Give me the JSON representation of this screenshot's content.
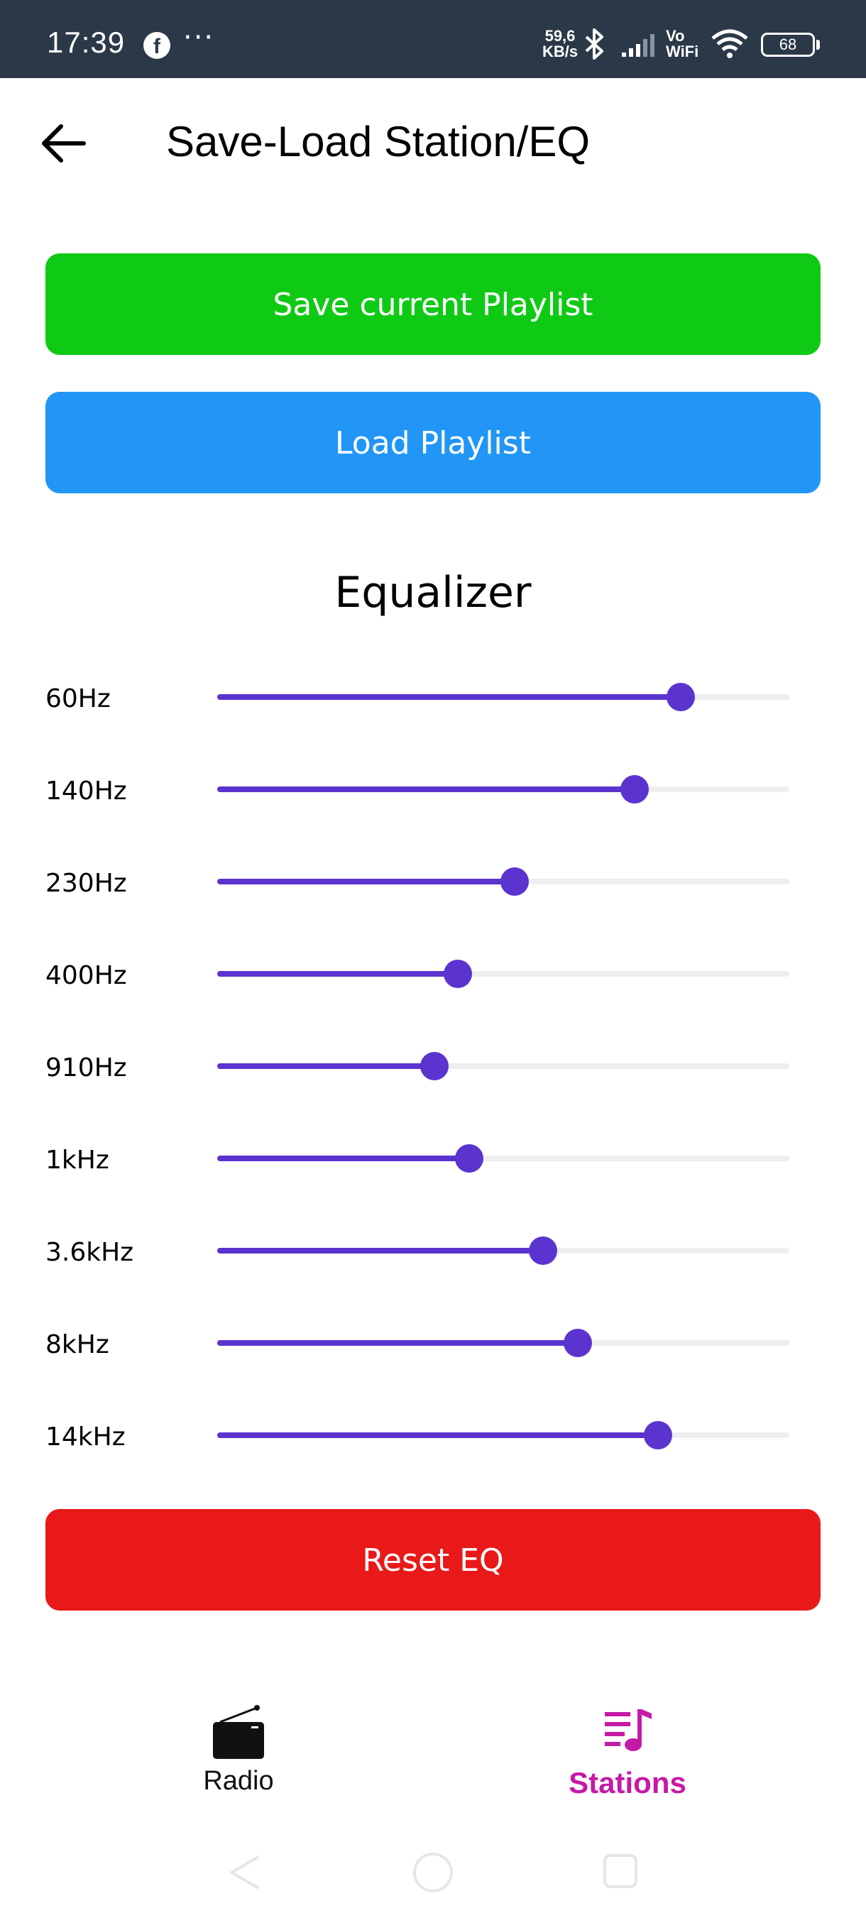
{
  "status_bar": {
    "time": "17:39",
    "app_icon": "facebook-icon",
    "overflow": "···",
    "net_speed_value": "59,6",
    "net_speed_unit": "KB/s",
    "vowifi_top": "Vo",
    "vowifi_bottom": "WiFi",
    "battery": "68"
  },
  "header": {
    "title": "Save-Load Station/EQ",
    "back_icon": "arrow-left-icon"
  },
  "actions": {
    "save_label": "Save current Playlist",
    "load_label": "Load Playlist",
    "reset_label": "Reset EQ"
  },
  "equalizer": {
    "title": "Equalizer",
    "bands": [
      {
        "label": "60Hz",
        "level": 0.81
      },
      {
        "label": "140Hz",
        "level": 0.73
      },
      {
        "label": "230Hz",
        "level": 0.52
      },
      {
        "label": "400Hz",
        "level": 0.42
      },
      {
        "label": "910Hz",
        "level": 0.38
      },
      {
        "label": "1kHz",
        "level": 0.44
      },
      {
        "label": "3.6kHz",
        "level": 0.57
      },
      {
        "label": "8kHz",
        "level": 0.63
      },
      {
        "label": "14kHz",
        "level": 0.77
      }
    ]
  },
  "bottom_nav": {
    "radio_label": "Radio",
    "stations_label": "Stations",
    "active": "Stations"
  },
  "colors": {
    "save": "#0fca14",
    "load": "#2196f7",
    "reset": "#e91919",
    "slider_accent": "#5b34cf",
    "active_tab": "#c51aa6",
    "status_bar": "#2b3848"
  }
}
